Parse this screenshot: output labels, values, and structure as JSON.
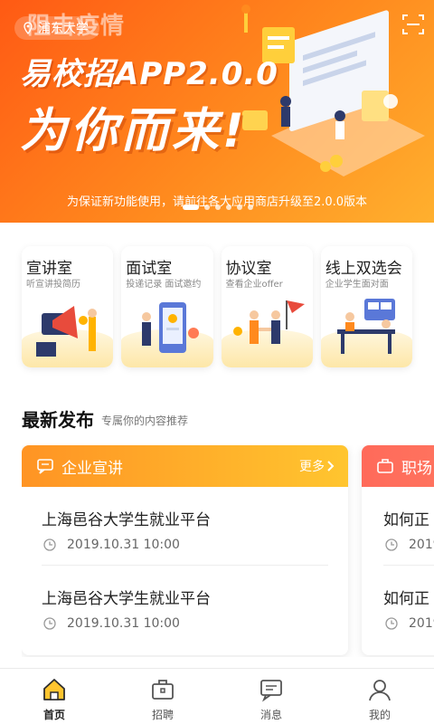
{
  "banner": {
    "location": "浦东大学",
    "watermark": "阻击疫情",
    "headline_line1": "易校招APP2.0.0",
    "headline_line2": "为你而来!",
    "note": "为保证新功能使用，请前往各大应用商店升级至2.0.0版本",
    "slide_count": 6,
    "active_slide": 1
  },
  "features": [
    {
      "title": "宣讲室",
      "subtitle": "听宣讲投简历"
    },
    {
      "title": "面试室",
      "subtitle": "投递记录  面试邀约"
    },
    {
      "title": "协议室",
      "subtitle": "查看企业offer"
    },
    {
      "title": "线上双选会",
      "subtitle": "企业学生面对面"
    }
  ],
  "latest": {
    "title": "最新发布",
    "subtitle": "专属你的内容推荐"
  },
  "panels": [
    {
      "title": "企业宣讲",
      "more": "更多",
      "items": [
        {
          "title": "上海邑谷大学生就业平台",
          "time": "2019.10.31 10:00"
        },
        {
          "title": "上海邑谷大学生就业平台",
          "time": "2019.10.31 10:00"
        }
      ]
    },
    {
      "title": "职场",
      "items": [
        {
          "title": "如何正",
          "time": "2019"
        },
        {
          "title": "如何正",
          "time": "2019"
        }
      ]
    }
  ],
  "tabs": [
    {
      "label": "首页",
      "icon": "home-icon",
      "active": true
    },
    {
      "label": "招聘",
      "icon": "briefcase-icon"
    },
    {
      "label": "消息",
      "icon": "message-icon"
    },
    {
      "label": "我的",
      "icon": "user-icon"
    }
  ],
  "colors": {
    "banner_start": "#ff5a14",
    "banner_end": "#ffb02e",
    "accent_yellow": "#ffc52f",
    "panel_orange": "#ff9424",
    "panel_red": "#ff6a5a"
  }
}
